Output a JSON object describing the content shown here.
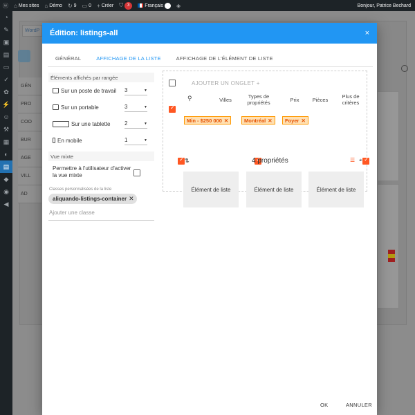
{
  "adminbar": {
    "sites": "Mes sites",
    "site": "Démo",
    "updates": "9",
    "comments": "0",
    "create": "Créer",
    "notifications": "3",
    "language": "Français",
    "greeting": "Bonjour, Patrice Bechard"
  },
  "background": {
    "link": "WordP",
    "sidebar": [
      "GÉN",
      "PRO",
      "COO",
      "BUR",
      "AGE",
      "VILL",
      "AD"
    ],
    "badge": "1"
  },
  "modal": {
    "title": "Édition: listings-all",
    "close": "×",
    "tabs": [
      "GÉNÉRAL",
      "AFFICHAGE DE LA LISTE",
      "AFFICHAGE DE L'ÉLÉMENT DE LISTE"
    ],
    "left": {
      "per_row_heading": "Éléments affichés par rangée",
      "devices": [
        {
          "label": "Sur un poste de travail",
          "value": "3"
        },
        {
          "label": "Sur un portable",
          "value": "3"
        },
        {
          "label": "Sur une tablette",
          "value": "2"
        },
        {
          "label": "En mobile",
          "value": "1"
        }
      ],
      "mixed_heading": "Vue mixte",
      "mixed_label": "Permettre à l'utilisateur d'activer la vue mixte",
      "classes_label": "Classes personnalisées de la liste",
      "class_chip": "aliquando-listings-container",
      "add_class_placeholder": "Ajouter une classe"
    },
    "preview": {
      "add_tab": "AJOUTER UN ONGLET +",
      "filter_headers": [
        "Villes",
        "Types de propriétés",
        "Prix",
        "Pièces",
        "Plus de critères"
      ],
      "chips": [
        "Min - $250 000",
        "Montréal",
        "Foyer"
      ],
      "count": "4 propriétés",
      "cards": [
        "Élément de liste",
        "Élément de liste",
        "Élément de liste"
      ]
    },
    "footer": {
      "ok": "OK",
      "cancel": "ANNULER"
    }
  },
  "colors": {
    "primary": "#2196f3",
    "accent": "#ff5722",
    "chip_bg": "#ffe0b2"
  }
}
